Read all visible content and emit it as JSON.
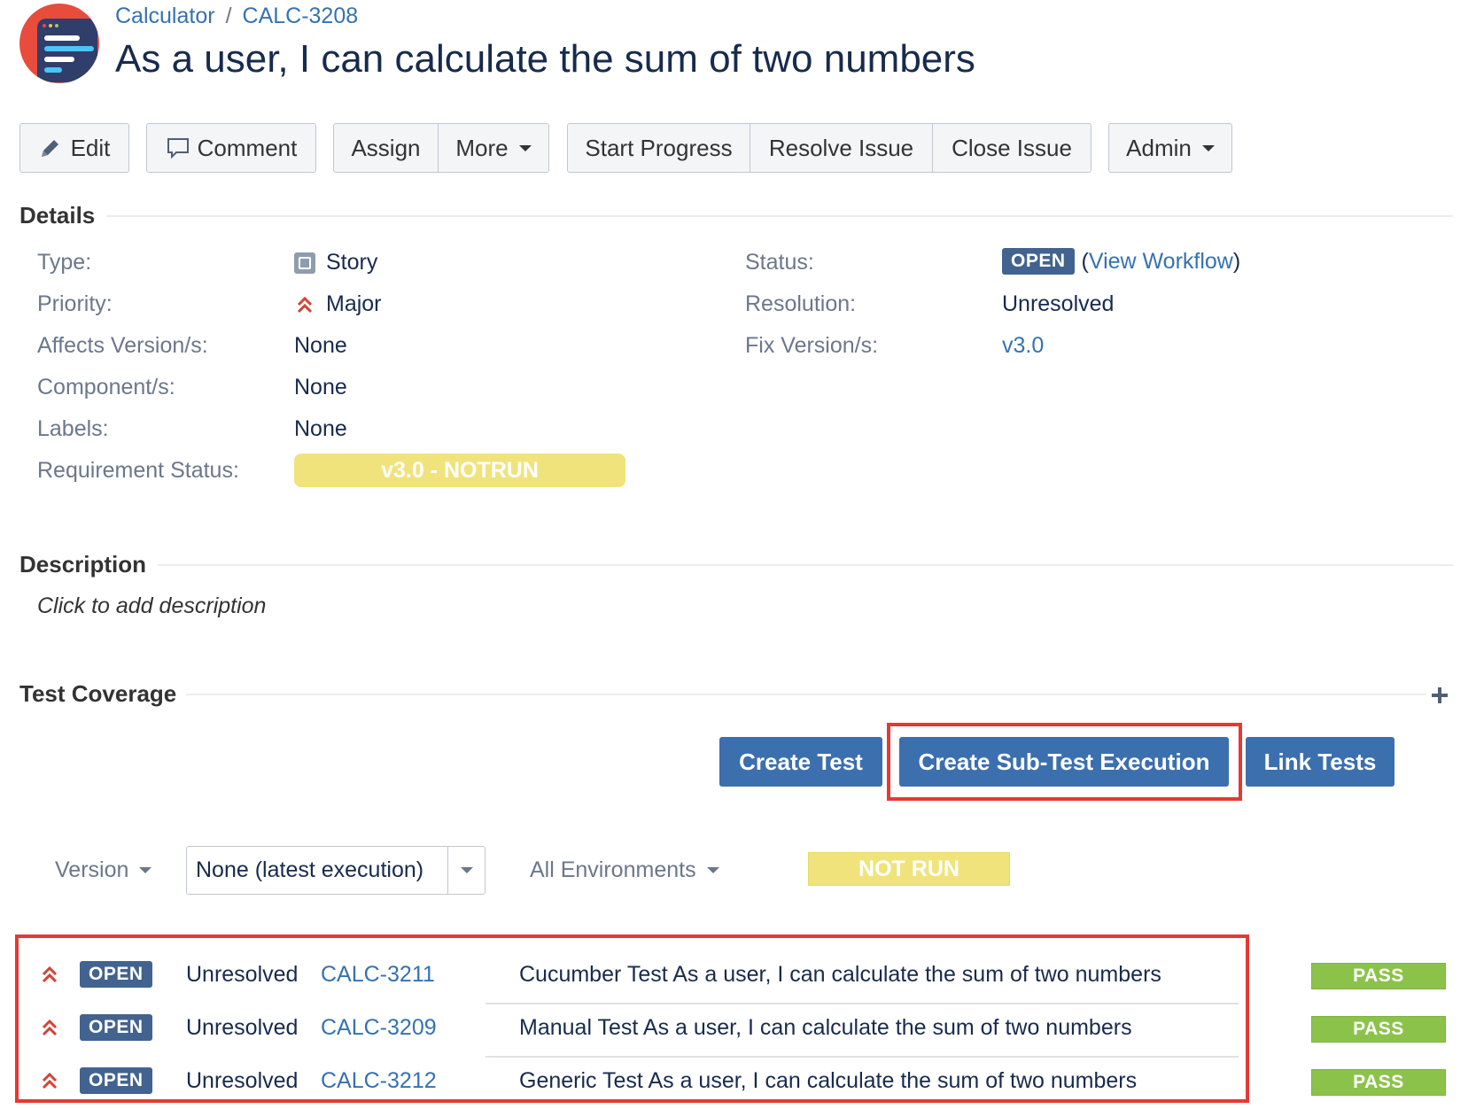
{
  "header": {
    "project": "Calculator",
    "separator": "/",
    "issue_key": "CALC-3208",
    "title": "As a user, I can calculate the sum of two numbers"
  },
  "toolbar": {
    "edit": "Edit",
    "comment": "Comment",
    "assign": "Assign",
    "more": "More",
    "start_progress": "Start Progress",
    "resolve_issue": "Resolve Issue",
    "close_issue": "Close Issue",
    "admin": "Admin"
  },
  "details": {
    "heading": "Details",
    "left": [
      {
        "label": "Type:",
        "value": "Story",
        "icon": "story-icon"
      },
      {
        "label": "Priority:",
        "value": "Major",
        "icon": "priority-major-icon"
      },
      {
        "label": "Affects Version/s:",
        "value": "None"
      },
      {
        "label": "Component/s:",
        "value": "None"
      },
      {
        "label": "Labels:",
        "value": "None"
      },
      {
        "label": "Requirement Status:",
        "value": "v3.0 - NOTRUN"
      }
    ],
    "right": {
      "status_label": "Status:",
      "status_value": "OPEN",
      "view_workflow_open": "(",
      "view_workflow": "View Workflow",
      "view_workflow_close": ")",
      "resolution_label": "Resolution:",
      "resolution_value": "Unresolved",
      "fix_version_label": "Fix Version/s:",
      "fix_version_value": "v3.0"
    }
  },
  "description": {
    "heading": "Description",
    "placeholder": "Click to add description"
  },
  "test_coverage": {
    "heading": "Test Coverage",
    "create_test": "Create Test",
    "create_sub_test_execution": "Create Sub-Test Execution",
    "link_tests": "Link Tests",
    "filters": {
      "version_label": "Version",
      "version_select": "None (latest execution)",
      "environments": "All Environments",
      "overall_status": "NOT RUN"
    },
    "tests": [
      {
        "status": "OPEN",
        "resolution": "Unresolved",
        "key": "CALC-3211",
        "summary": "Cucumber Test As a user, I can calculate the sum of two numbers",
        "result": "PASS"
      },
      {
        "status": "OPEN",
        "resolution": "Unresolved",
        "key": "CALC-3209",
        "summary": "Manual Test As a user, I can calculate the sum of two numbers",
        "result": "PASS"
      },
      {
        "status": "OPEN",
        "resolution": "Unresolved",
        "key": "CALC-3212",
        "summary": "Generic Test As a user, I can calculate the sum of two numbers",
        "result": "PASS"
      }
    ]
  },
  "colors": {
    "link": "#3572b0",
    "primary_button": "#3c6fae",
    "open_lozenge": "#42638f",
    "notrun": "#f1e37b",
    "pass": "#8bc34a",
    "highlight": "#e53935",
    "priority": "#d04437"
  }
}
